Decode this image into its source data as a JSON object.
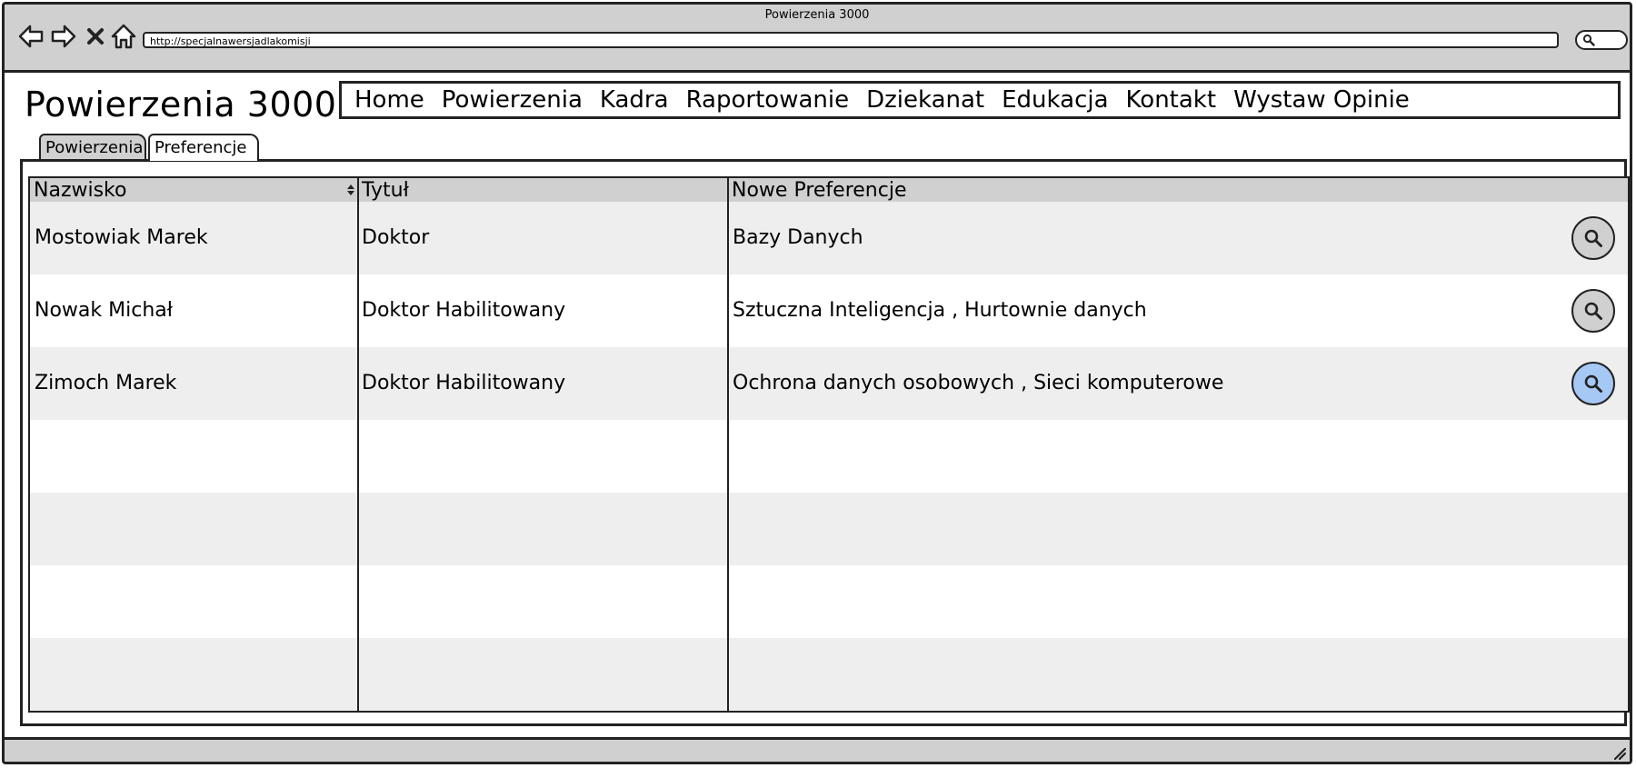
{
  "window": {
    "title": "Powierzenia 3000"
  },
  "browser": {
    "url": "http://specjalnawersjadlakomisji"
  },
  "app": {
    "title": "Powierzenia 3000"
  },
  "nav": {
    "items": [
      "Home",
      "Powierzenia",
      "Kadra",
      "Raportowanie",
      "Dziekanat",
      "Edukacja",
      "Kontakt",
      "Wystaw Opinie"
    ]
  },
  "tabs": {
    "items": [
      "Powierzenia",
      "Preferencje"
    ],
    "active": "Preferencje"
  },
  "table": {
    "columns": [
      "Nazwisko",
      "Tytuł",
      "Nowe Preferencje"
    ],
    "rows": [
      {
        "name": "Mostowiak Marek",
        "title": "Doktor",
        "prefs": "Bazy Danych"
      },
      {
        "name": "Nowak Michał",
        "title": "Doktor Habilitowany",
        "prefs": "Sztuczna Inteligencja , Hurtownie danych"
      },
      {
        "name": "Zimoch Marek",
        "title": "Doktor Habilitowany",
        "prefs": "Ochrona danych osobowych , Sieci komputerowe"
      }
    ]
  },
  "colors": {
    "chrome": "#d0d0d0",
    "row_alt": "#eeeeee",
    "selected_button": "#a6c8f5"
  },
  "icons": [
    "back-arrow-icon",
    "forward-arrow-icon",
    "stop-icon",
    "home-icon",
    "search-icon",
    "sort-icon",
    "magnifier-icon",
    "resize-grip-icon"
  ]
}
